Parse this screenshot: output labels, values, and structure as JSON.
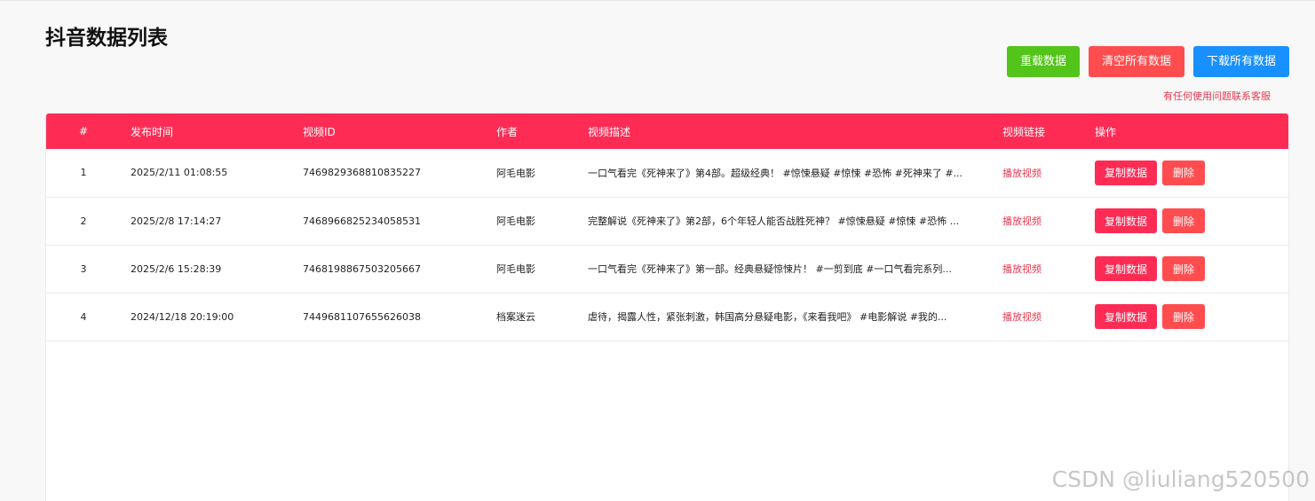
{
  "page": {
    "title": "抖音数据列表",
    "support_text": "有任何使用问题联系客服",
    "watermark": "CSDN @liuliang520500"
  },
  "toolbar": {
    "reload_label": "重载数据",
    "clear_label": "清空所有数据",
    "download_label": "下载所有数据"
  },
  "colors": {
    "header_bg": "#fe2c55",
    "reload_btn": "#52c41a",
    "clear_btn": "#ff4d4f",
    "download_btn": "#1890ff",
    "link": "#e5394f"
  },
  "table": {
    "headers": {
      "index": "#",
      "time": "发布时间",
      "video_id": "视频ID",
      "author": "作者",
      "desc": "视频描述",
      "link": "视频链接",
      "ops": "操作"
    },
    "rows": [
      {
        "index": "1",
        "time": "2025/2/11 01:08:55",
        "video_id": "7469829368810835227",
        "author": "阿毛电影",
        "desc": "一口气看完《死神来了》第4部。超级经典！ #惊悚悬疑 #惊悚 #恐怖 #死神来了 #...",
        "link": "播放视频",
        "copy": "复制数据",
        "delete": "删除"
      },
      {
        "index": "2",
        "time": "2025/2/8 17:14:27",
        "video_id": "7468966825234058531",
        "author": "阿毛电影",
        "desc": "完整解说《死神来了》第2部，6个年轻人能否战胜死神？ #惊悚悬疑 #惊悚 #恐怖 ...",
        "link": "播放视频",
        "copy": "复制数据",
        "delete": "删除"
      },
      {
        "index": "3",
        "time": "2025/2/6 15:28:39",
        "video_id": "7468198867503205667",
        "author": "阿毛电影",
        "desc": "一口气看完《死神来了》第一部。经典悬疑惊悚片！ #一剪到底 #一口气看完系列...",
        "link": "播放视频",
        "copy": "复制数据",
        "delete": "删除"
      },
      {
        "index": "4",
        "time": "2024/12/18 20:19:00",
        "video_id": "7449681107655626038",
        "author": "档案迷云",
        "desc": "虐待，揭露人性，紧张刺激，韩国高分悬疑电影，《来看我吧》 #电影解说 #我的...",
        "link": "播放视频",
        "copy": "复制数据",
        "delete": "删除"
      }
    ]
  }
}
